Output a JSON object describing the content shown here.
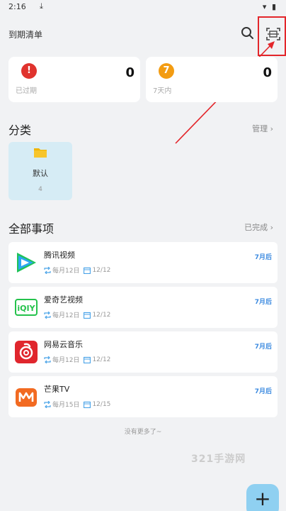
{
  "status_bar": {
    "time": "2:16",
    "icons": [
      "screenshot-icon",
      "download-icon",
      "wifi-icon",
      "battery-icon"
    ]
  },
  "app_bar": {
    "title": "到期清单",
    "search_icon": "search-icon",
    "scan_icon": "scan-icon"
  },
  "stats": [
    {
      "label": "已过期",
      "count": "0",
      "badge": "!",
      "color": "#e0332e"
    },
    {
      "label": "7天内",
      "count": "0",
      "badge": "7",
      "color": "#f39c12"
    }
  ],
  "categories": {
    "title": "分类",
    "manage_label": "管理 ›",
    "items": [
      {
        "name": "默认",
        "count": "4"
      }
    ]
  },
  "all_items": {
    "title": "全部事项",
    "completed_label": "已完成 ›",
    "items": [
      {
        "name": "腾讯视频",
        "repeat": "每月12日",
        "date": "12/12",
        "due": "7月后",
        "logo": "tencent-video-logo"
      },
      {
        "name": "爱奇艺视频",
        "repeat": "每月12日",
        "date": "12/12",
        "due": "7月后",
        "logo": "iqiyi-logo"
      },
      {
        "name": "网易云音乐",
        "repeat": "每月12日",
        "date": "12/12",
        "due": "7月后",
        "logo": "netease-music-logo"
      },
      {
        "name": "芒果TV",
        "repeat": "每月15日",
        "date": "12/15",
        "due": "7月后",
        "logo": "mango-tv-logo"
      }
    ]
  },
  "footer_note": "没有更多了~",
  "watermark": "321手游网",
  "fab_label": "+",
  "colors": {
    "accent": "#3d8be0",
    "category_bg": "#d6ecf5",
    "fab": "#8fd0f1",
    "highlight": "#e3262b"
  }
}
